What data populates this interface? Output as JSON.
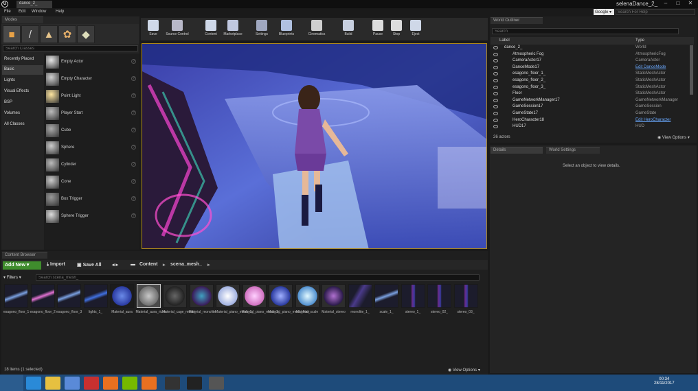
{
  "window": {
    "doc_tab": "dance_2_",
    "user": "selenaDance_2_",
    "minimize": "–",
    "maximize": "□",
    "close": "✕"
  },
  "menu": [
    "File",
    "Edit",
    "Window",
    "Help"
  ],
  "help": {
    "provider": "Google",
    "search_placeholder": "Search For Help"
  },
  "modes": {
    "tab": "Modes",
    "search_placeholder": "Search Classes",
    "icons": [
      "place-mode-icon",
      "paint-mode-icon",
      "landscape-mode-icon",
      "foliage-mode-icon",
      "geometry-mode-icon"
    ],
    "categories": [
      "Recently Placed",
      "Basic",
      "Lights",
      "Visual Effects",
      "BSP",
      "Volumes",
      "All Classes"
    ],
    "selected_category": "Basic",
    "items": [
      "Empty Actor",
      "Empty Character",
      "Point Light",
      "Player Start",
      "Cube",
      "Sphere",
      "Cylinder",
      "Cone",
      "Box Trigger",
      "Sphere Trigger"
    ]
  },
  "toolbar": [
    "Save",
    "Source Control",
    "Content",
    "Marketplace",
    "Settings",
    "Blueprints",
    "Cinematics",
    "Build",
    "Pause",
    "Stop",
    "Eject"
  ],
  "content_browser": {
    "tab": "Content Browser",
    "add_new": "Add New",
    "import": "Import",
    "save_all": "Save All",
    "path": [
      "Content",
      "scena_mesh_"
    ],
    "filters": "Filters",
    "search_placeholder": "Search scena_mesh_",
    "assets": [
      {
        "label": "esagono_floor_1",
        "kind": "mesh-flat"
      },
      {
        "label": "esagono_floor_2",
        "kind": "mesh-flat-pink"
      },
      {
        "label": "esagono_floor_3",
        "kind": "mesh-flat"
      },
      {
        "label": "lights_1_",
        "kind": "mesh-wave"
      },
      {
        "label": "Material_aura",
        "kind": "sphere-blue"
      },
      {
        "label": "Material_aura_riche",
        "kind": "sphere-grey",
        "selected": true
      },
      {
        "label": "Material_cage_mesh_",
        "kind": "sphere-dark"
      },
      {
        "label": "Material_monolite",
        "kind": "sphere-purple"
      },
      {
        "label": "Material_piano_mesh_1_",
        "kind": "sphere-white"
      },
      {
        "label": "Material_piano_mesh_2_",
        "kind": "sphere-pink"
      },
      {
        "label": "Material_piano_mesh_floor",
        "kind": "sphere-navy"
      },
      {
        "label": "Material_scale",
        "kind": "sphere-cyan"
      },
      {
        "label": "Material_stereo",
        "kind": "sphere-violet"
      },
      {
        "label": "monolite_1_",
        "kind": "mesh-shard"
      },
      {
        "label": "scale_1_",
        "kind": "mesh-flat"
      },
      {
        "label": "stereo_1_",
        "kind": "mesh-tower"
      },
      {
        "label": "stereo_02_",
        "kind": "mesh-tower"
      },
      {
        "label": "stereo_03_",
        "kind": "mesh-tower"
      }
    ],
    "status": "18 items (1 selected)",
    "view_options": "View Options"
  },
  "outliner": {
    "tab": "World Outliner",
    "search_placeholder": "Search",
    "col_label": "Label",
    "col_type": "Type",
    "rows": [
      {
        "label": "dance_2_",
        "type": "World",
        "indent": 0,
        "link": false
      },
      {
        "label": "Atmospheric Fog",
        "type": "AtmosphericFog",
        "indent": 2,
        "link": false
      },
      {
        "label": "CameraActor17",
        "type": "CameraActor",
        "indent": 2,
        "link": false
      },
      {
        "label": "DanceMode17",
        "type": "Edit DanceMode",
        "indent": 2,
        "link": true
      },
      {
        "label": "esagono_floor_1_",
        "type": "StaticMeshActor",
        "indent": 2,
        "link": false
      },
      {
        "label": "esagono_floor_2_",
        "type": "StaticMeshActor",
        "indent": 2,
        "link": false
      },
      {
        "label": "esagono_floor_3_",
        "type": "StaticMeshActor",
        "indent": 2,
        "link": false
      },
      {
        "label": "Floor",
        "type": "StaticMeshActor",
        "indent": 2,
        "link": false
      },
      {
        "label": "GameNetworkManager17",
        "type": "GameNetworkManager",
        "indent": 2,
        "link": false
      },
      {
        "label": "GameSession17",
        "type": "GameSession",
        "indent": 2,
        "link": false
      },
      {
        "label": "GameState17",
        "type": "GameState",
        "indent": 2,
        "link": false
      },
      {
        "label": "HeroCharacter18",
        "type": "Edit HeroCharacter",
        "indent": 2,
        "link": true
      },
      {
        "label": "HUD17",
        "type": "HUD",
        "indent": 2,
        "link": false
      }
    ],
    "count": "26 actors",
    "view_options": "View Options"
  },
  "details": {
    "tab_details": "Details",
    "tab_world": "World Settings",
    "empty": "Select an object to view details."
  },
  "taskbar": {
    "icons": [
      "ie-icon",
      "file-explorer-icon",
      "visual-studio-icon",
      "app-icon",
      "firefox-icon",
      "nvidia-icon",
      "blender-icon",
      "epic-games-icon",
      "unreal-engine-icon",
      "unity-icon"
    ],
    "time": "00:34",
    "date": "28/11/2017"
  }
}
